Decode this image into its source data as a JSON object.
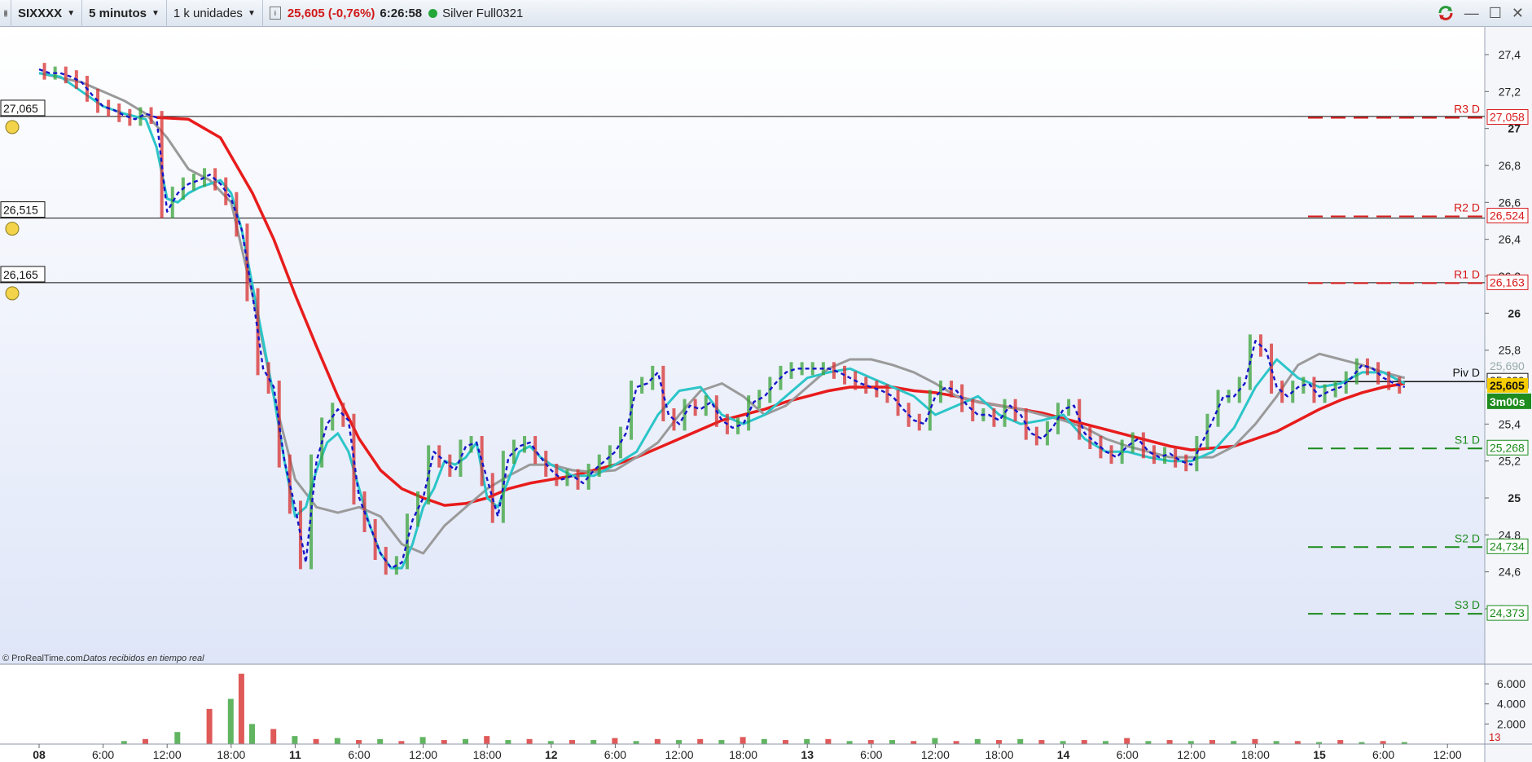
{
  "toolbar": {
    "symbol": "SIXXXX",
    "timeframe": "5 minutos",
    "units": "1 k unidades",
    "last_price": "25,605 (-0,76%)",
    "clock": "6:26:58",
    "instrument_name": "Silver Full0321",
    "icons": [
      "grip-icon",
      "info-icon",
      "sync-icon",
      "minimize-icon",
      "maximize-icon",
      "close-icon"
    ]
  },
  "footer_note": {
    "brand": "© ProRealTime.com",
    "status": "Datos recibidos en tiempo real"
  },
  "colors": {
    "up_candle": "#3aa23a",
    "down_candle": "#d83030",
    "ma_slow": "#e81c1c",
    "ma_mid": "#9a9a9a",
    "ma_fast": "#2cc5c8",
    "dashed_line": "#1515c8",
    "resistance": "#d81818",
    "support": "#1a8a1a",
    "background_top": "#ffffff",
    "background_bottom": "#dfe6f8",
    "badge_current": "#f5cc00",
    "badge_timer": "#1f8c1f"
  },
  "chart_data": {
    "type": "line",
    "title": "",
    "price_axis": {
      "range": [
        24.1,
        27.55
      ],
      "ticks": [
        {
          "v": 27.4,
          "label": "27,4",
          "bold": false
        },
        {
          "v": 27.2,
          "label": "27,2",
          "bold": false
        },
        {
          "v": 27.0,
          "label": "27",
          "bold": true
        },
        {
          "v": 26.8,
          "label": "26,8",
          "bold": false
        },
        {
          "v": 26.6,
          "label": "26,6",
          "bold": false
        },
        {
          "v": 26.4,
          "label": "26,4",
          "bold": false
        },
        {
          "v": 26.2,
          "label": "26,2",
          "bold": false
        },
        {
          "v": 26.0,
          "label": "26",
          "bold": true
        },
        {
          "v": 25.8,
          "label": "25,8",
          "bold": false
        },
        {
          "v": 25.4,
          "label": "25,4",
          "bold": false
        },
        {
          "v": 25.2,
          "label": "25,2",
          "bold": false
        },
        {
          "v": 25.0,
          "label": "25",
          "bold": true
        },
        {
          "v": 24.8,
          "label": "24,8",
          "bold": false
        },
        {
          "v": 24.6,
          "label": "24,6",
          "bold": false
        },
        {
          "v": 24.4,
          "label": "24,4",
          "bold": false
        }
      ]
    },
    "volume_axis": {
      "range": [
        0,
        7.3
      ],
      "ticks": [
        {
          "v": 6,
          "label": "6.000"
        },
        {
          "v": 4,
          "label": "4.000"
        },
        {
          "v": 2,
          "label": "2.000"
        }
      ],
      "current_label": "13"
    },
    "x_axis": {
      "range": [
        0,
        164
      ],
      "ticks": [
        {
          "x": 0,
          "label": "08",
          "bold": true
        },
        {
          "x": 6,
          "label": "6:00",
          "bold": false
        },
        {
          "x": 12,
          "label": "12:00",
          "bold": false
        },
        {
          "x": 18,
          "label": "18:00",
          "bold": false
        },
        {
          "x": 24,
          "label": "11",
          "bold": true
        },
        {
          "x": 30,
          "label": "6:00",
          "bold": false
        },
        {
          "x": 36,
          "label": "12:00",
          "bold": false
        },
        {
          "x": 42,
          "label": "18:00",
          "bold": false
        },
        {
          "x": 48,
          "label": "12",
          "bold": true
        },
        {
          "x": 54,
          "label": "6:00",
          "bold": false
        },
        {
          "x": 60,
          "label": "12:00",
          "bold": false
        },
        {
          "x": 66,
          "label": "18:00",
          "bold": false
        },
        {
          "x": 72,
          "label": "13",
          "bold": true
        },
        {
          "x": 78,
          "label": "6:00",
          "bold": false
        },
        {
          "x": 84,
          "label": "12:00",
          "bold": false
        },
        {
          "x": 90,
          "label": "18:00",
          "bold": false
        },
        {
          "x": 96,
          "label": "14",
          "bold": true
        },
        {
          "x": 102,
          "label": "6:00",
          "bold": false
        },
        {
          "x": 108,
          "label": "12:00",
          "bold": false
        },
        {
          "x": 114,
          "label": "18:00",
          "bold": false
        },
        {
          "x": 120,
          "label": "15",
          "bold": true
        },
        {
          "x": 126,
          "label": "6:00",
          "bold": false
        },
        {
          "x": 132,
          "label": "12:00",
          "bold": false
        }
      ]
    },
    "alert_lines": [
      {
        "value": 27.065,
        "label": "27,065"
      },
      {
        "value": 26.515,
        "label": "26,515"
      },
      {
        "value": 26.165,
        "label": "26,165"
      }
    ],
    "pivot_levels": [
      {
        "name": "R3 D",
        "value": 27.058,
        "label": "27,058",
        "kind": "resistance"
      },
      {
        "name": "R2 D",
        "value": 26.524,
        "label": "26,524",
        "kind": "resistance"
      },
      {
        "name": "R1 D",
        "value": 26.163,
        "label": "26,163",
        "kind": "resistance"
      },
      {
        "name": "Piv D",
        "value": 25.63,
        "label": "25,629",
        "kind": "pivot"
      },
      {
        "name": "S1 D",
        "value": 25.268,
        "label": "25,268",
        "kind": "support"
      },
      {
        "name": "S2 D",
        "value": 24.734,
        "label": "24,734",
        "kind": "support"
      },
      {
        "name": "S3 D",
        "value": 24.373,
        "label": "24,373",
        "kind": "support"
      }
    ],
    "current": {
      "value": 25.605,
      "label": "25,605",
      "timer": "3m00s",
      "hidden_label": "25,690"
    },
    "series": [
      {
        "style": "price",
        "x": [
          0,
          1,
          2,
          3,
          4,
          5,
          6,
          7,
          8,
          9,
          10,
          11,
          12,
          13,
          14,
          15,
          16,
          17,
          18,
          19,
          20,
          21,
          22,
          23,
          24,
          25,
          26,
          27,
          28,
          29,
          30,
          31,
          32,
          33,
          34,
          35,
          36,
          37,
          38,
          39,
          40,
          41,
          42,
          43,
          44,
          45,
          46,
          47,
          48,
          49,
          50,
          51,
          52,
          53,
          54,
          55,
          56,
          57,
          58,
          59,
          60,
          61,
          62,
          63,
          64,
          65,
          66,
          67,
          68,
          69,
          70,
          71,
          72,
          73,
          74,
          75,
          76,
          77,
          78,
          79,
          80,
          81,
          82,
          83,
          84,
          85,
          86,
          87,
          88,
          89,
          90,
          91,
          92,
          93,
          94,
          95,
          96,
          97,
          98,
          99,
          100,
          101,
          102,
          103,
          104,
          105,
          106,
          107,
          108,
          109,
          110,
          111,
          112,
          113,
          114,
          115,
          116,
          117,
          118,
          119,
          120,
          121,
          122,
          123,
          124,
          125,
          126,
          127,
          128
        ],
        "values": [
          27.32,
          27.3,
          27.3,
          27.28,
          27.25,
          27.18,
          27.12,
          27.1,
          27.07,
          27.05,
          27.08,
          27.06,
          26.55,
          26.65,
          26.7,
          26.72,
          26.75,
          26.7,
          26.62,
          26.45,
          26.1,
          25.7,
          25.6,
          25.2,
          24.95,
          24.65,
          25.2,
          25.4,
          25.48,
          25.42,
          25.0,
          24.85,
          24.7,
          24.62,
          24.65,
          24.88,
          25.0,
          25.25,
          25.2,
          25.15,
          25.28,
          25.3,
          25.1,
          24.9,
          25.22,
          25.28,
          25.3,
          25.22,
          25.15,
          25.1,
          25.12,
          25.08,
          25.15,
          25.2,
          25.25,
          25.35,
          25.6,
          25.62,
          25.68,
          25.45,
          25.4,
          25.5,
          25.48,
          25.52,
          25.42,
          25.38,
          25.4,
          25.52,
          25.55,
          25.62,
          25.68,
          25.7,
          25.7,
          25.7,
          25.7,
          25.68,
          25.65,
          25.62,
          25.6,
          25.58,
          25.55,
          25.48,
          25.42,
          25.4,
          25.55,
          25.6,
          25.58,
          25.5,
          25.45,
          25.45,
          25.42,
          25.5,
          25.45,
          25.35,
          25.32,
          25.38,
          25.48,
          25.5,
          25.35,
          25.3,
          25.25,
          25.22,
          25.28,
          25.32,
          25.25,
          25.22,
          25.24,
          25.2,
          25.18,
          25.3,
          25.42,
          25.55,
          25.55,
          25.62,
          25.85,
          25.8,
          25.6,
          25.55,
          25.6,
          25.62,
          25.55,
          25.58,
          25.6,
          25.65,
          25.72,
          25.7,
          25.65,
          25.62,
          25.6
        ]
      },
      {
        "style": "fast",
        "x": [
          0,
          2,
          4,
          6,
          8,
          10,
          11,
          12,
          13,
          14,
          15,
          16,
          17,
          18,
          19,
          20,
          21,
          22,
          23,
          24,
          25,
          26,
          27,
          28,
          29,
          30,
          31,
          32,
          33,
          34,
          35,
          36,
          37,
          38,
          39,
          40,
          41,
          42,
          43,
          44,
          45,
          46,
          47,
          48,
          50,
          52,
          54,
          56,
          58,
          60,
          62,
          64,
          66,
          68,
          70,
          72,
          74,
          76,
          78,
          80,
          82,
          84,
          86,
          88,
          90,
          92,
          94,
          96,
          98,
          100,
          102,
          104,
          106,
          108,
          110,
          112,
          114,
          116,
          118,
          120,
          122,
          124,
          126,
          128
        ],
        "values": [
          27.3,
          27.28,
          27.2,
          27.12,
          27.08,
          27.05,
          26.9,
          26.62,
          26.6,
          26.65,
          26.68,
          26.7,
          26.72,
          26.65,
          26.45,
          26.15,
          25.85,
          25.55,
          25.2,
          24.9,
          24.95,
          25.15,
          25.3,
          25.35,
          25.25,
          25.05,
          24.85,
          24.7,
          24.62,
          24.62,
          24.75,
          24.95,
          25.05,
          25.2,
          25.18,
          25.22,
          25.3,
          25.0,
          24.95,
          25.1,
          25.25,
          25.28,
          25.22,
          25.18,
          25.12,
          25.12,
          25.18,
          25.25,
          25.45,
          25.58,
          25.6,
          25.45,
          25.4,
          25.45,
          25.55,
          25.65,
          25.68,
          25.7,
          25.65,
          25.6,
          25.55,
          25.45,
          25.5,
          25.55,
          25.45,
          25.4,
          25.42,
          25.45,
          25.32,
          25.25,
          25.25,
          25.22,
          25.2,
          25.2,
          25.25,
          25.38,
          25.6,
          25.75,
          25.65,
          25.6,
          25.62,
          25.68,
          25.68,
          25.62
        ]
      },
      {
        "style": "mid",
        "x": [
          0,
          4,
          8,
          10,
          12,
          14,
          16,
          18,
          20,
          22,
          24,
          26,
          28,
          30,
          32,
          34,
          36,
          38,
          40,
          42,
          44,
          46,
          48,
          50,
          52,
          54,
          56,
          58,
          60,
          62,
          64,
          66,
          68,
          70,
          72,
          74,
          76,
          78,
          80,
          82,
          84,
          86,
          88,
          90,
          92,
          94,
          96,
          98,
          100,
          102,
          104,
          106,
          108,
          110,
          112,
          114,
          116,
          118,
          120,
          122,
          124,
          126,
          128
        ],
        "values": [
          27.3,
          27.25,
          27.15,
          27.08,
          26.95,
          26.78,
          26.72,
          26.6,
          26.1,
          25.55,
          25.1,
          24.95,
          24.92,
          24.95,
          24.9,
          24.75,
          24.7,
          24.85,
          24.95,
          25.05,
          25.12,
          25.18,
          25.18,
          25.15,
          25.14,
          25.15,
          25.22,
          25.3,
          25.45,
          25.58,
          25.62,
          25.55,
          25.45,
          25.5,
          25.6,
          25.7,
          25.75,
          25.75,
          25.72,
          25.68,
          25.62,
          25.55,
          25.52,
          25.5,
          25.48,
          25.45,
          25.42,
          25.38,
          25.32,
          25.28,
          25.25,
          25.22,
          25.22,
          25.22,
          25.28,
          25.4,
          25.55,
          25.72,
          25.78,
          25.75,
          25.72,
          25.68,
          25.65
        ]
      },
      {
        "style": "slow",
        "x": [
          11,
          14,
          17,
          20,
          22,
          24,
          26,
          28,
          30,
          32,
          34,
          36,
          38,
          40,
          42,
          44,
          46,
          48,
          50,
          52,
          54,
          56,
          58,
          60,
          62,
          64,
          66,
          68,
          70,
          72,
          74,
          76,
          78,
          80,
          82,
          84,
          86,
          88,
          90,
          92,
          94,
          96,
          98,
          100,
          102,
          104,
          106,
          108,
          110,
          112,
          114,
          116,
          118,
          120,
          122,
          124,
          126,
          128
        ],
        "values": [
          27.06,
          27.05,
          26.95,
          26.65,
          26.4,
          26.1,
          25.82,
          25.55,
          25.32,
          25.15,
          25.05,
          25.0,
          24.96,
          24.97,
          25.0,
          25.05,
          25.08,
          25.1,
          25.12,
          25.15,
          25.18,
          25.22,
          25.27,
          25.32,
          25.37,
          25.42,
          25.45,
          25.48,
          25.52,
          25.55,
          25.58,
          25.6,
          25.6,
          25.6,
          25.58,
          25.57,
          25.55,
          25.52,
          25.5,
          25.48,
          25.46,
          25.43,
          25.4,
          25.37,
          25.34,
          25.31,
          25.28,
          25.26,
          25.27,
          25.28,
          25.32,
          25.36,
          25.42,
          25.48,
          25.53,
          25.57,
          25.6,
          25.62
        ]
      }
    ],
    "volume": {
      "x": [
        8,
        10,
        13,
        16,
        18,
        19,
        20,
        22,
        24,
        26,
        28,
        30,
        32,
        34,
        36,
        38,
        40,
        42,
        44,
        46,
        48,
        50,
        52,
        54,
        56,
        58,
        60,
        62,
        64,
        66,
        68,
        70,
        72,
        74,
        76,
        78,
        80,
        82,
        84,
        86,
        88,
        90,
        92,
        94,
        96,
        98,
        100,
        102,
        104,
        106,
        108,
        110,
        112,
        114,
        116,
        118,
        120,
        122,
        124,
        126,
        128
      ],
      "values": [
        0.3,
        0.5,
        1.2,
        3.5,
        4.5,
        7.0,
        2.0,
        1.5,
        0.8,
        0.5,
        0.6,
        0.4,
        0.5,
        0.3,
        0.7,
        0.4,
        0.5,
        0.8,
        0.4,
        0.5,
        0.3,
        0.4,
        0.4,
        0.6,
        0.3,
        0.5,
        0.4,
        0.5,
        0.4,
        0.7,
        0.5,
        0.4,
        0.5,
        0.5,
        0.3,
        0.4,
        0.4,
        0.3,
        0.6,
        0.3,
        0.5,
        0.4,
        0.5,
        0.4,
        0.3,
        0.4,
        0.3,
        0.6,
        0.3,
        0.4,
        0.3,
        0.4,
        0.3,
        0.5,
        0.3,
        0.3,
        0.2,
        0.4,
        0.2,
        0.3,
        0.2
      ]
    }
  }
}
